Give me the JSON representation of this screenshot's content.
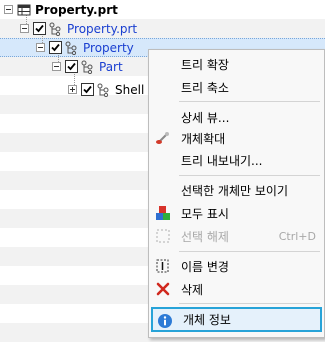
{
  "tree": {
    "root": {
      "label": "Property.prt",
      "icon": "table-icon"
    },
    "child": {
      "label": "Property.prt",
      "icon": "tree-structure-icon"
    },
    "selected": {
      "label": "Property",
      "icon": "tree-structure-icon"
    },
    "part": {
      "label": "Part",
      "icon": "tree-structure-icon"
    },
    "shell": {
      "label": "Shell",
      "icon": "tree-structure-icon"
    }
  },
  "menu": {
    "expand_tree": "트리 확장",
    "collapse_tree": "트리 축소",
    "detail_view": "상세 뷰...",
    "zoom_entity": "개체확대",
    "export_tree": "트리 내보내기...",
    "show_selected_only": "선택한 개체만 보이기",
    "show_all": "모두 표시",
    "deselect": "선택 해제",
    "deselect_shortcut": "Ctrl+D",
    "rename": "이름 변경",
    "delete": "삭제",
    "entity_info": "개체 정보"
  },
  "colors": {
    "link_blue": "#1a3fd0",
    "highlight_border": "#27a3d8",
    "selection_bg": "#d6e8fb"
  }
}
